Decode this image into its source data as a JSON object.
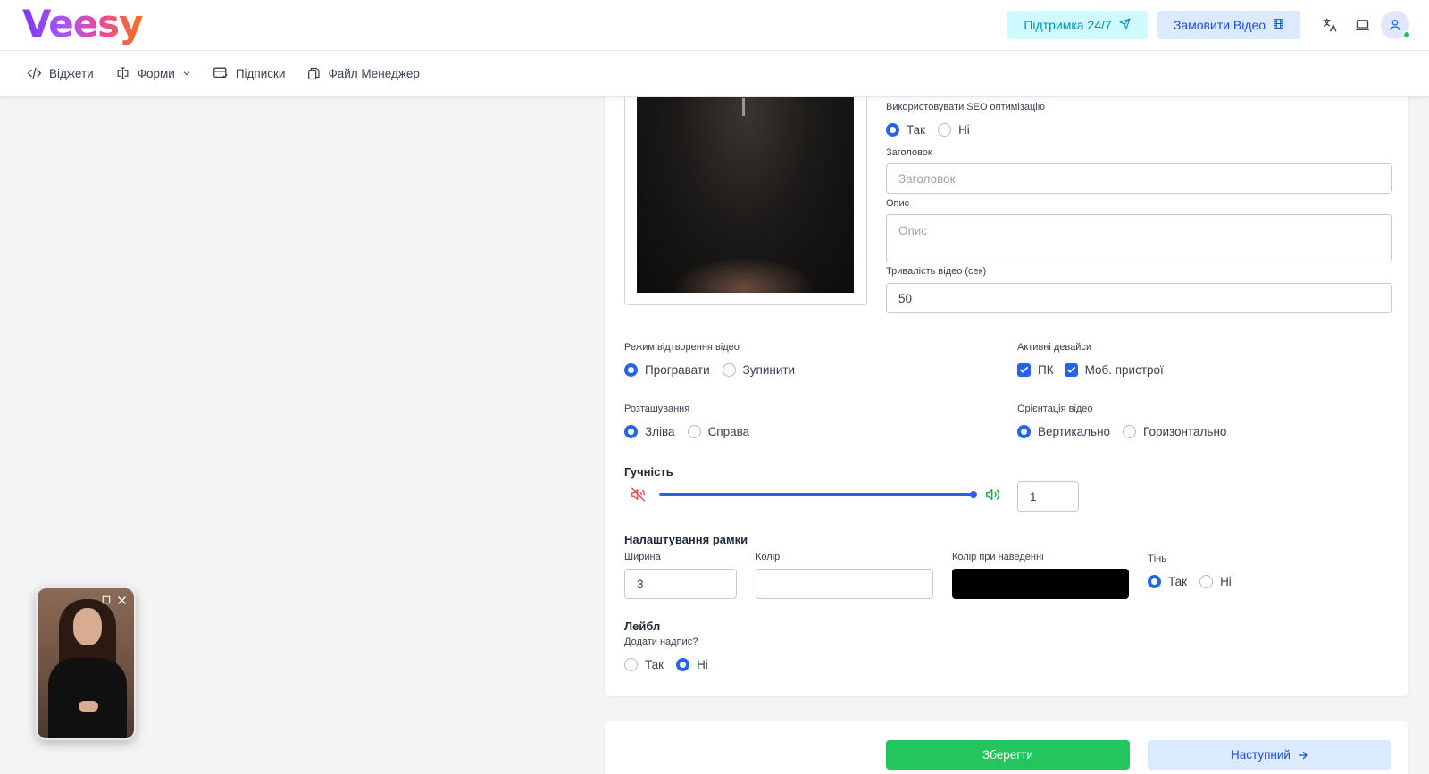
{
  "app": {
    "logo": "Veesy"
  },
  "header": {
    "support_label": "Підтримка 24/7",
    "order_label": "Замовити Відео",
    "icons": [
      "translate-icon",
      "laptop-icon",
      "user-icon"
    ]
  },
  "nav": {
    "widgets": "Віджети",
    "forms": "Форми",
    "subscriptions": "Підписки",
    "file_manager": "Файл Менеджер"
  },
  "seo": {
    "label": "Використовувати SEO оптимізацію",
    "yes": "Так",
    "no": "Ні",
    "selected": "Так"
  },
  "title_field": {
    "label": "Заголовок",
    "placeholder": "Заголовок"
  },
  "description_field": {
    "label": "Опис",
    "placeholder": "Опис"
  },
  "duration_field": {
    "label": "Тривалість відео (сек)",
    "value": "50"
  },
  "playback": {
    "label": "Режим відтворення відео",
    "play": "Програвати",
    "stop": "Зупинити",
    "selected": "Програвати"
  },
  "devices": {
    "label": "Активні девайси",
    "pc": "ПК",
    "mobile": "Моб. пристрої",
    "pc_checked": true,
    "mobile_checked": true
  },
  "position": {
    "label": "Розташування",
    "left": "Зліва",
    "right": "Справа",
    "selected": "Зліва"
  },
  "orientation": {
    "label": "Орієнтація відео",
    "vertical": "Вертикально",
    "horizontal": "Горизонтально",
    "selected": "Вертикально"
  },
  "volume": {
    "title": "Гучність",
    "value": "1",
    "level": 1.0
  },
  "frame": {
    "title": "Налаштування рамки",
    "width_label": "Ширина",
    "width_value": "3",
    "color_label": "Колір",
    "color_value": "",
    "hover_color_label": "Колір при наведенні",
    "hover_color": "#000000",
    "shadow_label": "Тінь",
    "shadow_yes": "Так",
    "shadow_no": "Ні",
    "shadow_selected": "Так"
  },
  "label_section": {
    "title": "Лейбл",
    "question": "Додати надпис?",
    "yes": "Так",
    "no": "Ні",
    "selected": "Ні"
  },
  "footer": {
    "save": "Зберегти",
    "next": "Наступний"
  },
  "colors": {
    "accent": "#2563eb",
    "save": "#22c55e",
    "support_bg": "#cffafe",
    "order_bg": "#dbeafe"
  }
}
